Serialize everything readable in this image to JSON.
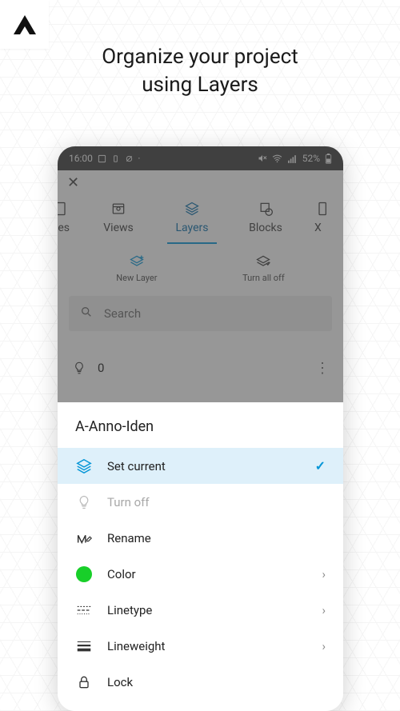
{
  "headline": "Organize your project\nusing Layers",
  "statusbar": {
    "time": "16:00",
    "battery": "52%"
  },
  "tabs": {
    "partial_left": "es",
    "views": "Views",
    "layers": "Layers",
    "blocks": "Blocks",
    "partial_right": "X"
  },
  "actions": {
    "new_layer": "New Layer",
    "turn_all_off": "Turn all off"
  },
  "search": {
    "placeholder": "Search"
  },
  "layer_row": {
    "name": "0"
  },
  "sheet": {
    "title": "A-Anno-Iden",
    "items": {
      "set_current": "Set current",
      "turn_off": "Turn off",
      "rename": "Rename",
      "color": "Color",
      "linetype": "Linetype",
      "lineweight": "Lineweight",
      "lock": "Lock"
    },
    "color_value": "#18cf29"
  }
}
